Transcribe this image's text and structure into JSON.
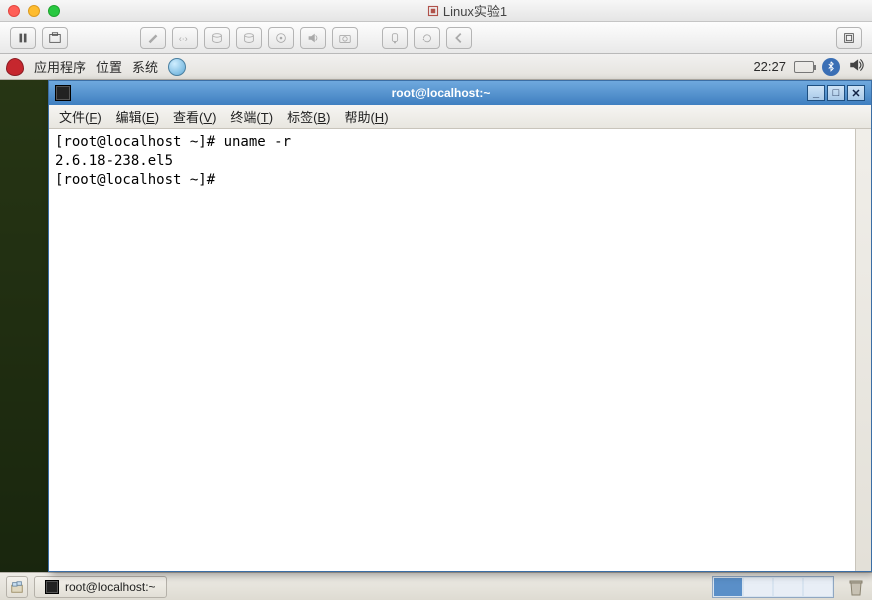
{
  "host_window": {
    "title": "Linux实验1",
    "toolbar_icons": [
      "pause-icon",
      "screenshot-icon",
      "wrench-icon",
      "net-icon",
      "disk-icon",
      "disk2-icon",
      "lock-icon",
      "sound-icon",
      "camera-icon",
      "mouse-icon",
      "cycle-icon",
      "back-icon",
      "fullscreen-icon"
    ]
  },
  "gnome_top": {
    "menus": [
      "应用程序",
      "位置",
      "系统"
    ],
    "clock": "22:27"
  },
  "terminal": {
    "title": "root@localhost:~",
    "menu": [
      {
        "label": "文件",
        "key": "F"
      },
      {
        "label": "编辑",
        "key": "E"
      },
      {
        "label": "查看",
        "key": "V"
      },
      {
        "label": "终端",
        "key": "T"
      },
      {
        "label": "标签",
        "key": "B"
      },
      {
        "label": "帮助",
        "key": "H"
      }
    ],
    "lines": [
      "[root@localhost ~]# uname -r",
      "2.6.18-238.el5",
      "[root@localhost ~]#"
    ],
    "window_buttons": {
      "min": "_",
      "max": "□",
      "close": "✕"
    }
  },
  "gnome_bottom": {
    "task": "root@localhost:~",
    "workspaces": 4,
    "active_workspace": 0
  }
}
